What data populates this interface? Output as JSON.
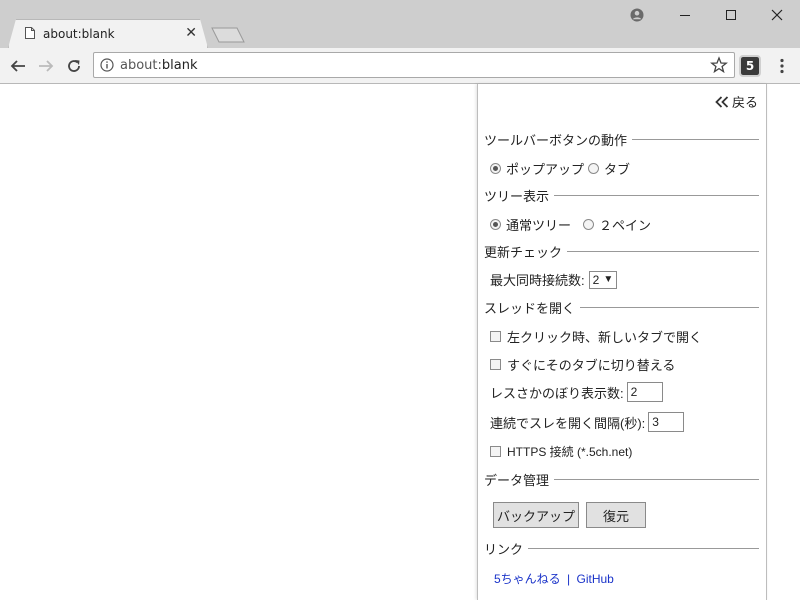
{
  "browser": {
    "tab_title": "about:blank",
    "address": {
      "scheme": "about:",
      "rest": "blank"
    },
    "extension_badge": "5"
  },
  "popup": {
    "back_label": "戻る",
    "toolbar_section": {
      "title": "ツールバーボタンの動作",
      "options": [
        {
          "label": "ポップアップ",
          "selected": true
        },
        {
          "label": "タブ",
          "selected": false
        }
      ]
    },
    "tree_section": {
      "title": "ツリー表示",
      "options": [
        {
          "label": "通常ツリー",
          "selected": true
        },
        {
          "label": "２ペイン",
          "selected": false
        }
      ]
    },
    "update_section": {
      "title": "更新チェック",
      "max_conn_label": "最大同時接続数:",
      "max_conn_value": "2",
      "dropdown_arrow": "▼"
    },
    "thread_section": {
      "title": "スレッドを開く",
      "left_click_label": "左クリック時、新しいタブで開く",
      "switch_tab_label": "すぐにそのタブに切り替える",
      "res_count_label": "レスさかのぼり表示数:",
      "res_count_value": "2",
      "interval_label": "連続でスレを開く間隔(秒):",
      "interval_value": "3",
      "https_label": "HTTPS 接続 (*.5ch.net)"
    },
    "data_section": {
      "title": "データ管理",
      "backup_label": "バックアップ",
      "restore_label": "復元"
    },
    "link_section": {
      "title": "リンク",
      "link1": "5ちゃんねる",
      "separator": "|",
      "link2": "GitHub"
    }
  }
}
